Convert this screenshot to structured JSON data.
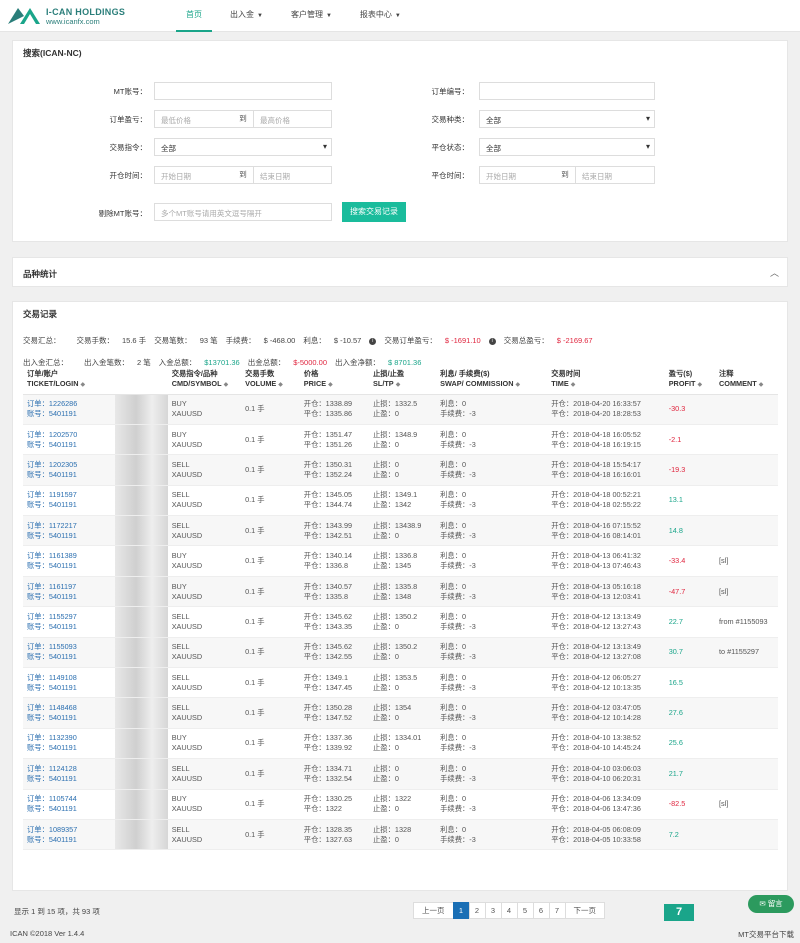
{
  "header": {
    "brand": "I-CAN HOLDINGS",
    "site": "www.icanfx.com",
    "nav": [
      {
        "label": "首页",
        "caret": false,
        "active": true
      },
      {
        "label": "出入金",
        "caret": true,
        "active": false
      },
      {
        "label": "客户管理",
        "caret": true,
        "active": false
      },
      {
        "label": "报表中心",
        "caret": true,
        "active": false
      }
    ]
  },
  "search": {
    "title": "搜索(ICAN-NC)",
    "mt_account_label": "MT账号：",
    "order_no_label": "订单编号：",
    "profit_label": "订单盈亏：",
    "profit_min_placeholder": "最低价格",
    "to": "到",
    "profit_max_placeholder": "最高价格",
    "symbol_label": "交易种类：",
    "symbol_value": "全部",
    "cmd_label": "交易指令：",
    "cmd_value": "全部",
    "close_status_label": "平仓状态：",
    "close_status_value": "全部",
    "open_time_label": "开仓时间：",
    "open_start_placeholder": "开始日期",
    "open_end_placeholder": "结束日期",
    "close_time_label": "平仓时间：",
    "close_start_placeholder": "开始日期",
    "close_end_placeholder": "结束日期",
    "exclude_label": "剔除MT账号：",
    "exclude_placeholder": "多个MT账号请用英文逗号隔开",
    "search_button": "搜索交易记录"
  },
  "stats_panel": {
    "title": "品种统计",
    "collapse_icon": "chevron-up-icon"
  },
  "records": {
    "title": "交易记录",
    "summary1": [
      {
        "label": "交易汇总：",
        "value": ""
      },
      {
        "label": "交易手数：",
        "value": "15.6 手"
      },
      {
        "label": "交易笔数：",
        "value": "93 笔"
      },
      {
        "label": "手续费：",
        "value": "$ -468.00"
      },
      {
        "label": "利息：",
        "value": "$ -10.57"
      },
      {
        "label": "交易订单盈亏：",
        "value": "$ -1691.10",
        "neg": true,
        "info": true
      },
      {
        "label": "交易总盈亏：",
        "value": "$ -2169.67",
        "neg": true,
        "info": true
      }
    ],
    "summary2": [
      {
        "label": "出入金汇总：",
        "value": ""
      },
      {
        "label": "出入金笔数：",
        "value": "2 笔"
      },
      {
        "label": "入金总额：",
        "value": "$13701.36",
        "pos": true
      },
      {
        "label": "出金总额：",
        "value": "$-5000.00",
        "neg": true
      },
      {
        "label": "出入金净额：",
        "value": "$ 8701.36",
        "pos": true
      }
    ],
    "columns": [
      {
        "line1": "订单/账户",
        "line2": "TICKET/LOGIN"
      },
      {
        "line1": "",
        "line2": ""
      },
      {
        "line1": "交易指令/品种",
        "line2": "CMD/SYMBOL"
      },
      {
        "line1": "交易手数",
        "line2": "VOLUME"
      },
      {
        "line1": "价格",
        "line2": "PRICE"
      },
      {
        "line1": "止损/止盈",
        "line2": "SL/TP"
      },
      {
        "line1": "利息/ 手续费($)",
        "line2": "SWAP/ COMMISSION"
      },
      {
        "line1": "交易时间",
        "line2": "TIME"
      },
      {
        "line1": "盈亏($)",
        "line2": "PROFIT"
      },
      {
        "line1": "注释",
        "line2": "COMMENT"
      }
    ],
    "rows": [
      {
        "ticket": "订单：1226286",
        "login": "账号：5401191",
        "cmd": "BUY",
        "symbol": "XAUUSD",
        "volume": "0.1 手",
        "open_price": "开仓：1338.89",
        "close_price": "平仓：1335.86",
        "sl": "止损：1332.5",
        "tp": "止盈：0",
        "swap": "利息：0",
        "commission": "手续费：-3",
        "open_time": "开仓：2018-04-20 16:33:57",
        "close_time": "平仓：2018-04-20 18:28:53",
        "profit": "-30.3",
        "neg": true,
        "comment": ""
      },
      {
        "ticket": "订单：1202570",
        "login": "账号：5401191",
        "cmd": "BUY",
        "symbol": "XAUUSD",
        "volume": "0.1 手",
        "open_price": "开仓：1351.47",
        "close_price": "平仓：1351.26",
        "sl": "止损：1348.9",
        "tp": "止盈：0",
        "swap": "利息：0",
        "commission": "手续费：-3",
        "open_time": "开仓：2018-04-18 16:05:52",
        "close_time": "平仓：2018-04-18 16:19:15",
        "profit": "-2.1",
        "neg": true,
        "comment": ""
      },
      {
        "ticket": "订单：1202305",
        "login": "账号：5401191",
        "cmd": "SELL",
        "symbol": "XAUUSD",
        "volume": "0.1 手",
        "open_price": "开仓：1350.31",
        "close_price": "平仓：1352.24",
        "sl": "止损：0",
        "tp": "止盈：0",
        "swap": "利息：0",
        "commission": "手续费：-3",
        "open_time": "开仓：2018-04-18 15:54:17",
        "close_time": "平仓：2018-04-18 16:16:01",
        "profit": "-19.3",
        "neg": true,
        "comment": ""
      },
      {
        "ticket": "订单：1191597",
        "login": "账号：5401191",
        "cmd": "SELL",
        "symbol": "XAUUSD",
        "volume": "0.1 手",
        "open_price": "开仓：1345.05",
        "close_price": "平仓：1344.74",
        "sl": "止损：1349.1",
        "tp": "止盈：1342",
        "swap": "利息：0",
        "commission": "手续费：-3",
        "open_time": "开仓：2018-04-18 00:52:21",
        "close_time": "平仓：2018-04-18 02:55:22",
        "profit": "13.1",
        "neg": false,
        "comment": ""
      },
      {
        "ticket": "订单：1172217",
        "login": "账号：5401191",
        "cmd": "SELL",
        "symbol": "XAUUSD",
        "volume": "0.1 手",
        "open_price": "开仓：1343.99",
        "close_price": "平仓：1342.51",
        "sl": "止损：13438.9",
        "tp": "止盈：0",
        "swap": "利息：0",
        "commission": "手续费：-3",
        "open_time": "开仓：2018-04-16 07:15:52",
        "close_time": "平仓：2018-04-16 08:14:01",
        "profit": "14.8",
        "neg": false,
        "comment": ""
      },
      {
        "ticket": "订单：1161389",
        "login": "账号：5401191",
        "cmd": "BUY",
        "symbol": "XAUUSD",
        "volume": "0.1 手",
        "open_price": "开仓：1340.14",
        "close_price": "平仓：1336.8",
        "sl": "止损：1336.8",
        "tp": "止盈：1345",
        "swap": "利息：0",
        "commission": "手续费：-3",
        "open_time": "开仓：2018-04-13 06:41:32",
        "close_time": "平仓：2018-04-13 07:46:43",
        "profit": "-33.4",
        "neg": true,
        "comment": "[sl]"
      },
      {
        "ticket": "订单：1161197",
        "login": "账号：5401191",
        "cmd": "BUY",
        "symbol": "XAUUSD",
        "volume": "0.1 手",
        "open_price": "开仓：1340.57",
        "close_price": "平仓：1335.8",
        "sl": "止损：1335.8",
        "tp": "止盈：1348",
        "swap": "利息：0",
        "commission": "手续费：-3",
        "open_time": "开仓：2018-04-13 05:16:18",
        "close_time": "平仓：2018-04-13 12:03:41",
        "profit": "-47.7",
        "neg": true,
        "comment": "[sl]"
      },
      {
        "ticket": "订单：1155297",
        "login": "账号：5401191",
        "cmd": "SELL",
        "symbol": "XAUUSD",
        "volume": "0.1 手",
        "open_price": "开仓：1345.62",
        "close_price": "平仓：1343.35",
        "sl": "止损：1350.2",
        "tp": "止盈：0",
        "swap": "利息：0",
        "commission": "手续费：-3",
        "open_time": "开仓：2018-04-12 13:13:49",
        "close_time": "平仓：2018-04-12 13:27:43",
        "profit": "22.7",
        "neg": false,
        "comment": "from #1155093"
      },
      {
        "ticket": "订单：1155093",
        "login": "账号：5401191",
        "cmd": "SELL",
        "symbol": "XAUUSD",
        "volume": "0.1 手",
        "open_price": "开仓：1345.62",
        "close_price": "平仓：1342.55",
        "sl": "止损：1350.2",
        "tp": "止盈：0",
        "swap": "利息：0",
        "commission": "手续费：-3",
        "open_time": "开仓：2018-04-12 13:13:49",
        "close_time": "平仓：2018-04-12 13:27:08",
        "profit": "30.7",
        "neg": false,
        "comment": "to #1155297"
      },
      {
        "ticket": "订单：1149108",
        "login": "账号：5401191",
        "cmd": "SELL",
        "symbol": "XAUUSD",
        "volume": "0.1 手",
        "open_price": "开仓：1349.1",
        "close_price": "平仓：1347.45",
        "sl": "止损：1353.5",
        "tp": "止盈：0",
        "swap": "利息：0",
        "commission": "手续费：-3",
        "open_time": "开仓：2018-04-12 06:05:27",
        "close_time": "平仓：2018-04-12 10:13:35",
        "profit": "16.5",
        "neg": false,
        "comment": ""
      },
      {
        "ticket": "订单：1148468",
        "login": "账号：5401191",
        "cmd": "SELL",
        "symbol": "XAUUSD",
        "volume": "0.1 手",
        "open_price": "开仓：1350.28",
        "close_price": "平仓：1347.52",
        "sl": "止损：1354",
        "tp": "止盈：0",
        "swap": "利息：0",
        "commission": "手续费：-3",
        "open_time": "开仓：2018-04-12 03:47:05",
        "close_time": "平仓：2018-04-12 10:14:28",
        "profit": "27.6",
        "neg": false,
        "comment": ""
      },
      {
        "ticket": "订单：1132390",
        "login": "账号：5401191",
        "cmd": "BUY",
        "symbol": "XAUUSD",
        "volume": "0.1 手",
        "open_price": "开仓：1337.36",
        "close_price": "平仓：1339.92",
        "sl": "止损：1334.01",
        "tp": "止盈：0",
        "swap": "利息：0",
        "commission": "手续费：-3",
        "open_time": "开仓：2018-04-10 13:38:52",
        "close_time": "平仓：2018-04-10 14:45:24",
        "profit": "25.6",
        "neg": false,
        "comment": ""
      },
      {
        "ticket": "订单：1124128",
        "login": "账号：5401191",
        "cmd": "SELL",
        "symbol": "XAUUSD",
        "volume": "0.1 手",
        "open_price": "开仓：1334.71",
        "close_price": "平仓：1332.54",
        "sl": "止损：0",
        "tp": "止盈：0",
        "swap": "利息：0",
        "commission": "手续费：-3",
        "open_time": "开仓：2018-04-10 03:06:03",
        "close_time": "平仓：2018-04-10 06:20:31",
        "profit": "21.7",
        "neg": false,
        "comment": ""
      },
      {
        "ticket": "订单：1105744",
        "login": "账号：5401191",
        "cmd": "BUY",
        "symbol": "XAUUSD",
        "volume": "0.1 手",
        "open_price": "开仓：1330.25",
        "close_price": "平仓：1322",
        "sl": "止损：1322",
        "tp": "止盈：0",
        "swap": "利息：0",
        "commission": "手续费：-3",
        "open_time": "开仓：2018-04-06 13:34:09",
        "close_time": "平仓：2018-04-06 13:47:36",
        "profit": "-82.5",
        "neg": true,
        "comment": "[sl]"
      },
      {
        "ticket": "订单：1089357",
        "login": "账号：5401191",
        "cmd": "SELL",
        "symbol": "XAUUSD",
        "volume": "0.1 手",
        "open_price": "开仓：1328.35",
        "close_price": "平仓：1327.63",
        "sl": "止损：1328",
        "tp": "止盈：0",
        "swap": "利息：0",
        "commission": "手续费：-3",
        "open_time": "开仓：2018-04-05 06:08:09",
        "close_time": "平仓：2018-04-05 10:33:58",
        "profit": "7.2",
        "neg": false,
        "comment": ""
      }
    ]
  },
  "pagination": {
    "info": "显示 1 到 15 项，共 93 项",
    "prev": "上一页",
    "pages": [
      "1",
      "2",
      "3",
      "4",
      "5",
      "6",
      "7"
    ],
    "active_page": "1",
    "next": "下一页"
  },
  "footer": {
    "copyright": "ICAN ©2018 Ver 1.4.4",
    "right_text": "MT交易平台下载",
    "chat_button": "留言",
    "badge": "7"
  },
  "colors": {
    "accent": "#1aa58a",
    "negative": "#e0263f",
    "page_active": "#1a6fb5"
  }
}
